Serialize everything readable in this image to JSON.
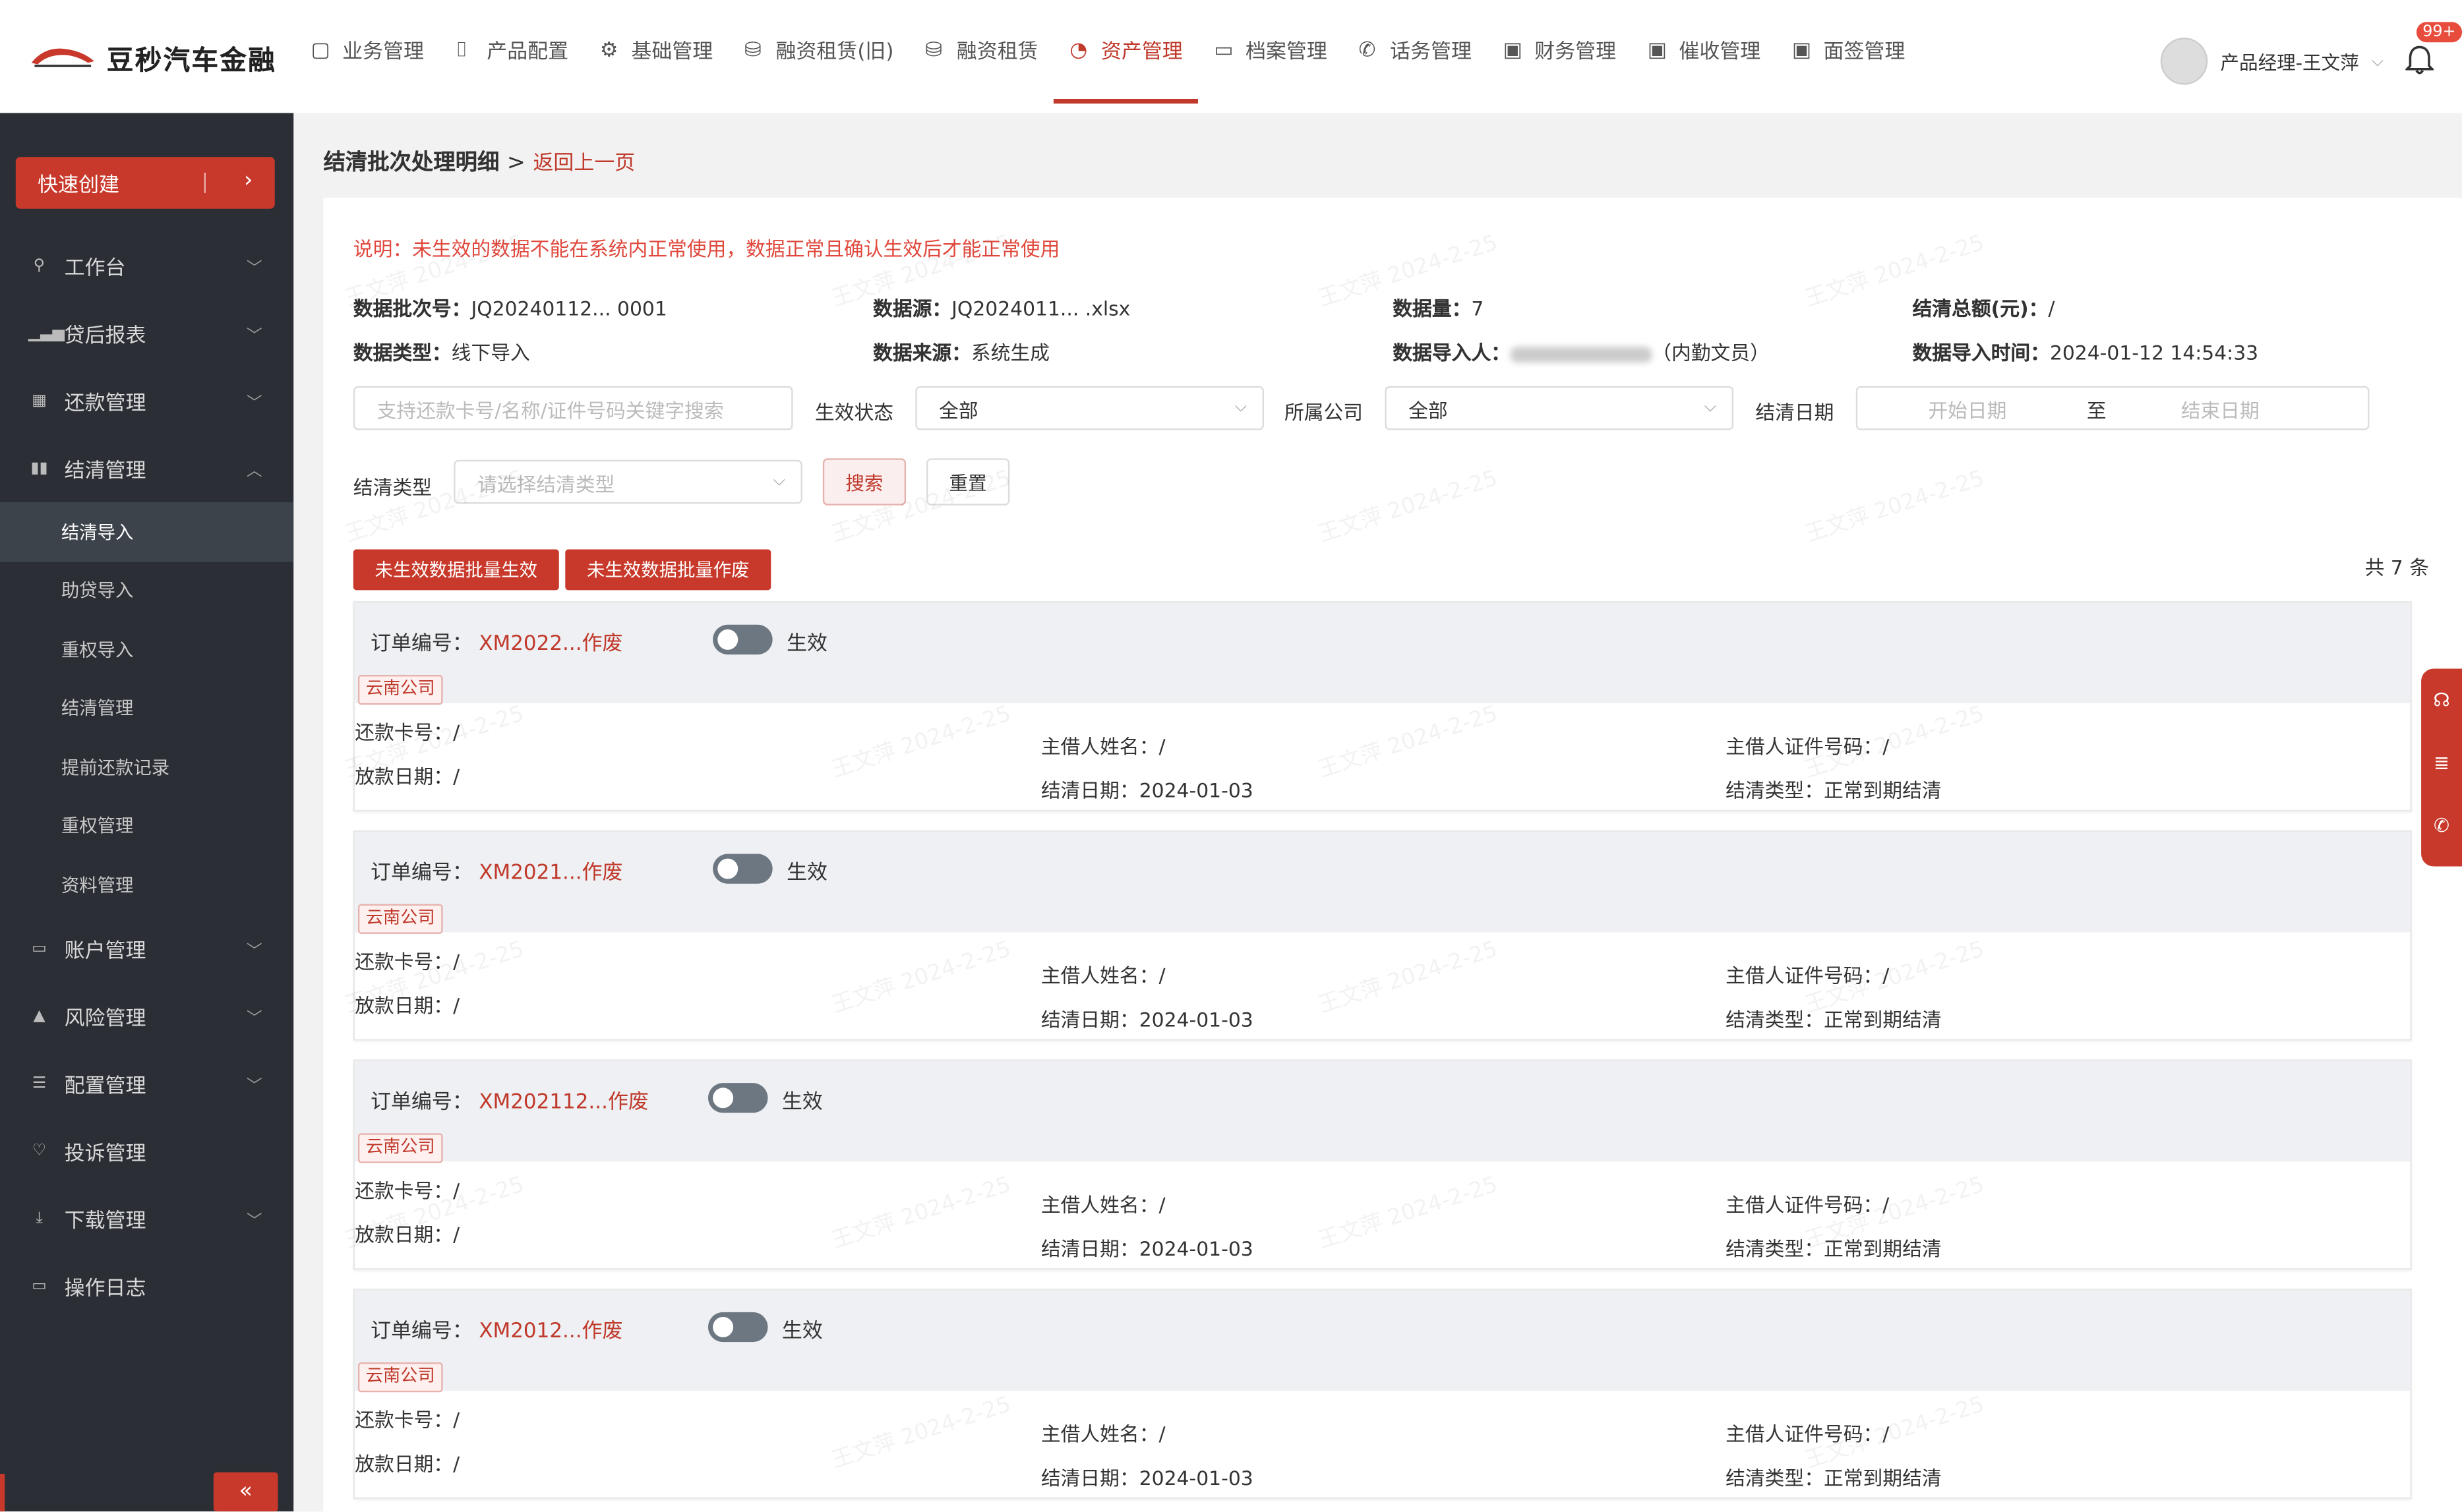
{
  "brand": {
    "name": "豆秒汽车金融"
  },
  "nav": {
    "items": [
      {
        "label": "业务管理",
        "icon": "clipboard-icon"
      },
      {
        "label": "产品配置",
        "icon": "bookmark-icon"
      },
      {
        "label": "基础管理",
        "icon": "gear-icon"
      },
      {
        "label": "融资租赁(旧)",
        "icon": "database-icon"
      },
      {
        "label": "融资租赁",
        "icon": "database-icon"
      },
      {
        "label": "资产管理",
        "icon": "pie-chart-icon",
        "active": true
      },
      {
        "label": "档案管理",
        "icon": "folder-icon"
      },
      {
        "label": "话务管理",
        "icon": "phone-icon"
      },
      {
        "label": "财务管理",
        "icon": "wallet-icon"
      },
      {
        "label": "催收管理",
        "icon": "wallet-icon"
      },
      {
        "label": "面签管理",
        "icon": "wallet-icon"
      }
    ],
    "user": "产品经理-王文萍",
    "badge": "99+"
  },
  "sidebar": {
    "quick_create": "快速创建",
    "items": [
      {
        "label": "工作台"
      },
      {
        "label": "贷后报表"
      },
      {
        "label": "还款管理"
      },
      {
        "label": "结清管理",
        "expanded": true,
        "children": [
          "结清导入",
          "助贷导入",
          "重权导入",
          "结清管理",
          "提前还款记录",
          "重权管理",
          "资料管理"
        ]
      },
      {
        "label": "账户管理"
      },
      {
        "label": "风险管理"
      },
      {
        "label": "配置管理"
      },
      {
        "label": "投诉管理"
      },
      {
        "label": "下载管理"
      },
      {
        "label": "操作日志"
      }
    ],
    "collapse": "«"
  },
  "page": {
    "title": "结清批次处理明细",
    "separator": ">",
    "back": "返回上一页",
    "notice": "说明：未生效的数据不能在系统内正常使用，数据正常且确认生效后才能正常使用"
  },
  "info": {
    "batch_label": "数据批次号：",
    "batch_value": "JQ20240112... 0001",
    "source_label": "数据源：",
    "source_value": "JQ2024011... .xlsx",
    "count_label": "数据量：",
    "count_value": "7",
    "total_label": "结清总额(元)：",
    "total_value": "/",
    "type_label": "数据类型：",
    "type_value": "线下导入",
    "from_label": "数据来源：",
    "from_value": "系统生成",
    "importer_label": "数据导入人：",
    "importer_value": "（内勤文员）",
    "time_label": "数据导入时间：",
    "time_value": "2024-01-12 14:54:33"
  },
  "filters": {
    "search_placeholder": "支持还款卡号/名称/证件号码关键字搜索",
    "status_label": "生效状态",
    "status_value": "全部",
    "company_label": "所属公司",
    "company_value": "全部",
    "date_label": "结清日期",
    "date_start": "开始日期",
    "date_to": "至",
    "date_end": "结束日期",
    "type_label": "结清类型",
    "type_placeholder": "请选择结清类型",
    "search_btn": "搜索",
    "reset_btn": "重置"
  },
  "actions": {
    "batch_effective": "未生效数据批量生效",
    "batch_void": "未生效数据批量作废",
    "total": "共 7 条"
  },
  "labels": {
    "order": "订单编号：",
    "card": "还款卡号：",
    "loan_date": "放款日期：",
    "borrower": "主借人姓名：",
    "settle_date": "结清日期：",
    "id_no": "主借人证件号码：",
    "settle_type": "结清类型："
  },
  "records": [
    {
      "order_no": "XM2022...作废",
      "toggle_label": "生效",
      "company": "云南公司",
      "card": "/",
      "loan_date": "/",
      "borrower": "/",
      "settle_date": "2024-01-03",
      "id_no": "/",
      "settle_type": "正常到期结清"
    },
    {
      "order_no": "XM2021...作废",
      "toggle_label": "生效",
      "company": "云南公司",
      "card": "/",
      "loan_date": "/",
      "borrower": "/",
      "settle_date": "2024-01-03",
      "id_no": "/",
      "settle_type": "正常到期结清"
    },
    {
      "order_no": "XM202112...作废",
      "toggle_label": "生效",
      "company": "云南公司",
      "card": "/",
      "loan_date": "/",
      "borrower": "/",
      "settle_date": "2024-01-03",
      "id_no": "/",
      "settle_type": "正常到期结清"
    },
    {
      "order_no": "XM2012...作废",
      "toggle_label": "生效",
      "company": "云南公司",
      "card": "/",
      "loan_date": "/",
      "borrower": "/",
      "settle_date": "2024-01-03",
      "id_no": "/",
      "settle_type": "正常到期结清"
    }
  ],
  "watermark": "王文萍 2024-2-25",
  "float_tools": [
    "headset-icon",
    "list-icon",
    "phone-icon"
  ],
  "colors": {
    "accent": "#c8392b",
    "sidebar": "#2b2f35"
  }
}
